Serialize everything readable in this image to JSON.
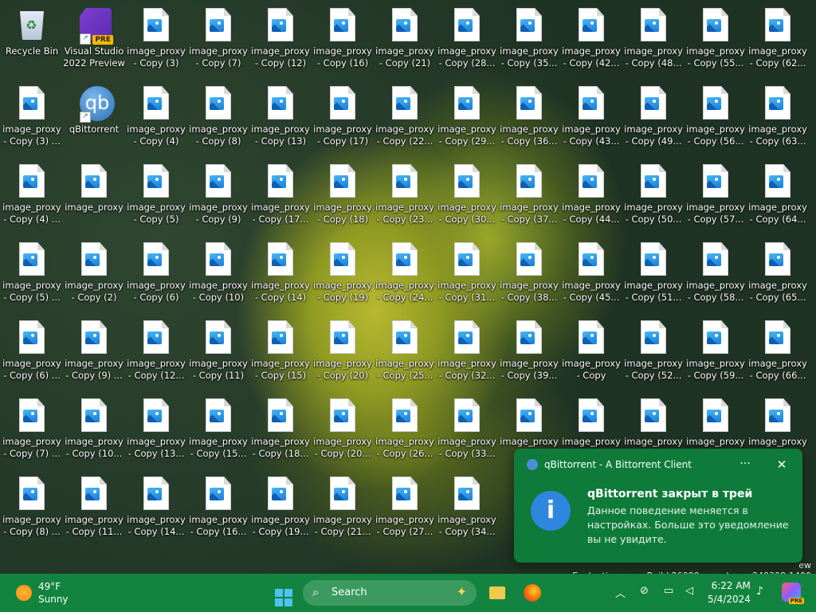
{
  "desktop": {
    "icons": [
      {
        "col": 0,
        "row": 0,
        "kind": "recycle",
        "l1": "Recycle Bin",
        "l2": ""
      },
      {
        "col": 1,
        "row": 0,
        "kind": "vs",
        "l1": "Visual Studio",
        "l2": "2022 Preview",
        "badge": "PRE"
      },
      {
        "col": 2,
        "row": 0,
        "kind": "file",
        "l1": "image_proxy",
        "l2": "- Copy (3)"
      },
      {
        "col": 3,
        "row": 0,
        "kind": "file",
        "l1": "image_proxy",
        "l2": "- Copy (7)"
      },
      {
        "col": 4,
        "row": 0,
        "kind": "file",
        "l1": "image_proxy",
        "l2": "- Copy (12)"
      },
      {
        "col": 5,
        "row": 0,
        "kind": "file",
        "l1": "image_proxy",
        "l2": "- Copy (16)"
      },
      {
        "col": 6,
        "row": 0,
        "kind": "file",
        "l1": "image_proxy",
        "l2": "- Copy (21)"
      },
      {
        "col": 7,
        "row": 0,
        "kind": "file",
        "l1": "image_proxy",
        "l2": "- Copy (28..."
      },
      {
        "col": 8,
        "row": 0,
        "kind": "file",
        "l1": "image_proxy",
        "l2": "- Copy (35..."
      },
      {
        "col": 9,
        "row": 0,
        "kind": "file",
        "l1": "image_proxy",
        "l2": "- Copy (42..."
      },
      {
        "col": 10,
        "row": 0,
        "kind": "file",
        "l1": "image_proxy",
        "l2": "- Copy (48..."
      },
      {
        "col": 11,
        "row": 0,
        "kind": "file",
        "l1": "image_proxy",
        "l2": "- Copy (55..."
      },
      {
        "col": 12,
        "row": 0,
        "kind": "file",
        "l1": "image_proxy",
        "l2": "- Copy (62..."
      },
      {
        "col": 0,
        "row": 1,
        "kind": "file",
        "l1": "image_proxy",
        "l2": "- Copy (3) ..."
      },
      {
        "col": 1,
        "row": 1,
        "kind": "qb",
        "l1": "qBittorrent",
        "l2": ""
      },
      {
        "col": 2,
        "row": 1,
        "kind": "file",
        "l1": "image_proxy",
        "l2": "- Copy (4)"
      },
      {
        "col": 3,
        "row": 1,
        "kind": "file",
        "l1": "image_proxy",
        "l2": "- Copy (8)"
      },
      {
        "col": 4,
        "row": 1,
        "kind": "file",
        "l1": "image_proxy",
        "l2": "- Copy (13)"
      },
      {
        "col": 5,
        "row": 1,
        "kind": "file",
        "l1": "image_proxy",
        "l2": "- Copy (17)"
      },
      {
        "col": 6,
        "row": 1,
        "kind": "file",
        "l1": "image_proxy",
        "l2": "- Copy (22..."
      },
      {
        "col": 7,
        "row": 1,
        "kind": "file",
        "l1": "image_proxy",
        "l2": "- Copy (29..."
      },
      {
        "col": 8,
        "row": 1,
        "kind": "file",
        "l1": "image_proxy",
        "l2": "- Copy (36..."
      },
      {
        "col": 9,
        "row": 1,
        "kind": "file",
        "l1": "image_proxy",
        "l2": "- Copy (43..."
      },
      {
        "col": 10,
        "row": 1,
        "kind": "file",
        "l1": "image_proxy",
        "l2": "- Copy (49..."
      },
      {
        "col": 11,
        "row": 1,
        "kind": "file",
        "l1": "image_proxy",
        "l2": "- Copy (56..."
      },
      {
        "col": 12,
        "row": 1,
        "kind": "file",
        "l1": "image_proxy",
        "l2": "- Copy (63..."
      },
      {
        "col": 0,
        "row": 2,
        "kind": "file",
        "l1": "image_proxy",
        "l2": "- Copy (4) ..."
      },
      {
        "col": 1,
        "row": 2,
        "kind": "file",
        "l1": "image_proxy",
        "l2": ""
      },
      {
        "col": 2,
        "row": 2,
        "kind": "file",
        "l1": "image_proxy",
        "l2": "- Copy (5)"
      },
      {
        "col": 3,
        "row": 2,
        "kind": "file",
        "l1": "image_proxy",
        "l2": "- Copy (9)"
      },
      {
        "col": 4,
        "row": 2,
        "kind": "file",
        "l1": "image_proxy",
        "l2": "- Copy (17..."
      },
      {
        "col": 5,
        "row": 2,
        "kind": "file",
        "l1": "image_proxy",
        "l2": "- Copy (18)"
      },
      {
        "col": 6,
        "row": 2,
        "kind": "file",
        "l1": "image_proxy",
        "l2": "- Copy (23..."
      },
      {
        "col": 7,
        "row": 2,
        "kind": "file",
        "l1": "image_proxy",
        "l2": "- Copy (30..."
      },
      {
        "col": 8,
        "row": 2,
        "kind": "file",
        "l1": "image_proxy",
        "l2": "- Copy (37..."
      },
      {
        "col": 9,
        "row": 2,
        "kind": "file",
        "l1": "image_proxy",
        "l2": "- Copy (44..."
      },
      {
        "col": 10,
        "row": 2,
        "kind": "file",
        "l1": "image_proxy",
        "l2": "- Copy (50..."
      },
      {
        "col": 11,
        "row": 2,
        "kind": "file",
        "l1": "image_proxy",
        "l2": "- Copy (57..."
      },
      {
        "col": 12,
        "row": 2,
        "kind": "file",
        "l1": "image_proxy",
        "l2": "- Copy (64..."
      },
      {
        "col": 0,
        "row": 3,
        "kind": "file",
        "l1": "image_proxy",
        "l2": "- Copy (5) ..."
      },
      {
        "col": 1,
        "row": 3,
        "kind": "file",
        "l1": "image_proxy",
        "l2": "- Copy (2)"
      },
      {
        "col": 2,
        "row": 3,
        "kind": "file",
        "l1": "image_proxy",
        "l2": "- Copy (6)"
      },
      {
        "col": 3,
        "row": 3,
        "kind": "file",
        "l1": "image_proxy",
        "l2": "- Copy (10)"
      },
      {
        "col": 4,
        "row": 3,
        "kind": "file",
        "l1": "image_proxy",
        "l2": "- Copy (14)"
      },
      {
        "col": 5,
        "row": 3,
        "kind": "file",
        "l1": "image_proxy",
        "l2": "- Copy (19)"
      },
      {
        "col": 6,
        "row": 3,
        "kind": "file",
        "l1": "image_proxy",
        "l2": "- Copy (24..."
      },
      {
        "col": 7,
        "row": 3,
        "kind": "file",
        "l1": "image_proxy",
        "l2": "- Copy (31..."
      },
      {
        "col": 8,
        "row": 3,
        "kind": "file",
        "l1": "image_proxy",
        "l2": "- Copy (38..."
      },
      {
        "col": 9,
        "row": 3,
        "kind": "file",
        "l1": "image_proxy",
        "l2": "- Copy (45..."
      },
      {
        "col": 10,
        "row": 3,
        "kind": "file",
        "l1": "image_proxy",
        "l2": "- Copy (51..."
      },
      {
        "col": 11,
        "row": 3,
        "kind": "file",
        "l1": "image_proxy",
        "l2": "- Copy (58..."
      },
      {
        "col": 12,
        "row": 3,
        "kind": "file",
        "l1": "image_proxy",
        "l2": "- Copy (65..."
      },
      {
        "col": 0,
        "row": 4,
        "kind": "file",
        "l1": "image_proxy",
        "l2": "- Copy (6) ..."
      },
      {
        "col": 1,
        "row": 4,
        "kind": "file",
        "l1": "image_proxy",
        "l2": "- Copy (9) ..."
      },
      {
        "col": 2,
        "row": 4,
        "kind": "file",
        "l1": "image_proxy",
        "l2": "- Copy (12..."
      },
      {
        "col": 3,
        "row": 4,
        "kind": "file",
        "l1": "image_proxy",
        "l2": "- Copy (11)"
      },
      {
        "col": 4,
        "row": 4,
        "kind": "file",
        "l1": "image_proxy",
        "l2": "- Copy (15)"
      },
      {
        "col": 5,
        "row": 4,
        "kind": "file",
        "l1": "image_proxy",
        "l2": "- Copy (20)"
      },
      {
        "col": 6,
        "row": 4,
        "kind": "file",
        "l1": "image_proxy",
        "l2": "- Copy (25..."
      },
      {
        "col": 7,
        "row": 4,
        "kind": "file",
        "l1": "image_proxy",
        "l2": "- Copy (32..."
      },
      {
        "col": 8,
        "row": 4,
        "kind": "file",
        "l1": "image_proxy",
        "l2": "- Copy (39..."
      },
      {
        "col": 9,
        "row": 4,
        "kind": "file",
        "l1": "image_proxy",
        "l2": "- Copy"
      },
      {
        "col": 10,
        "row": 4,
        "kind": "file",
        "l1": "image_proxy",
        "l2": "- Copy (52..."
      },
      {
        "col": 11,
        "row": 4,
        "kind": "file",
        "l1": "image_proxy",
        "l2": "- Copy (59..."
      },
      {
        "col": 12,
        "row": 4,
        "kind": "file",
        "l1": "image_proxy",
        "l2": "- Copy (66..."
      },
      {
        "col": 0,
        "row": 5,
        "kind": "file",
        "l1": "image_proxy",
        "l2": "- Copy (7) ..."
      },
      {
        "col": 1,
        "row": 5,
        "kind": "file",
        "l1": "image_proxy",
        "l2": "- Copy (10..."
      },
      {
        "col": 2,
        "row": 5,
        "kind": "file",
        "l1": "image_proxy",
        "l2": "- Copy (13..."
      },
      {
        "col": 3,
        "row": 5,
        "kind": "file",
        "l1": "image_proxy",
        "l2": "- Copy (15..."
      },
      {
        "col": 4,
        "row": 5,
        "kind": "file",
        "l1": "image_proxy",
        "l2": "- Copy (18..."
      },
      {
        "col": 5,
        "row": 5,
        "kind": "file",
        "l1": "image_proxy",
        "l2": "- Copy (20..."
      },
      {
        "col": 6,
        "row": 5,
        "kind": "file",
        "l1": "image_proxy",
        "l2": "- Copy (26..."
      },
      {
        "col": 7,
        "row": 5,
        "kind": "file",
        "l1": "image_proxy",
        "l2": "- Copy (33..."
      },
      {
        "col": 8,
        "row": 5,
        "kind": "file",
        "l1": "image_proxy",
        "l2": ""
      },
      {
        "col": 9,
        "row": 5,
        "kind": "file",
        "l1": "image_proxy",
        "l2": ""
      },
      {
        "col": 10,
        "row": 5,
        "kind": "file",
        "l1": "image_proxy",
        "l2": ""
      },
      {
        "col": 11,
        "row": 5,
        "kind": "file",
        "l1": "image_proxy",
        "l2": ""
      },
      {
        "col": 12,
        "row": 5,
        "kind": "file",
        "l1": "image_proxy",
        "l2": ""
      },
      {
        "col": 0,
        "row": 6,
        "kind": "file",
        "l1": "image_proxy",
        "l2": "- Copy (8) ..."
      },
      {
        "col": 1,
        "row": 6,
        "kind": "file",
        "l1": "image_proxy",
        "l2": "- Copy (11..."
      },
      {
        "col": 2,
        "row": 6,
        "kind": "file",
        "l1": "image_proxy",
        "l2": "- Copy (14..."
      },
      {
        "col": 3,
        "row": 6,
        "kind": "file",
        "l1": "image_proxy",
        "l2": "- Copy (16..."
      },
      {
        "col": 4,
        "row": 6,
        "kind": "file",
        "l1": "image_proxy",
        "l2": "- Copy (19..."
      },
      {
        "col": 5,
        "row": 6,
        "kind": "file",
        "l1": "image_proxy",
        "l2": "- Copy (21..."
      },
      {
        "col": 6,
        "row": 6,
        "kind": "file",
        "l1": "image_proxy",
        "l2": "- Copy (27..."
      },
      {
        "col": 7,
        "row": 6,
        "kind": "file",
        "l1": "image_proxy",
        "l2": "- Copy (34..."
      }
    ]
  },
  "watermark": {
    "line1": "ew",
    "line2": "Evaluation copy. Build 26080.ge_release.240308-1400"
  },
  "toast": {
    "app_name": "qBittorrent - A Bittorrent Client",
    "more_label": "···",
    "close_label": "✕",
    "info_glyph": "i",
    "title": "qBittorrent закрыт в трей",
    "body": "Данное поведение меняется в настройках. Больше это уведомление вы не увидите."
  },
  "taskbar": {
    "weather_temp": "49°F",
    "weather_desc": "Sunny",
    "search_placeholder": "Search",
    "search_spark": "✦",
    "tray_chevron": "︿",
    "clock_time": "6:22 AM",
    "clock_date": "5/4/2024",
    "copilot_badge": "PRE"
  },
  "colors": {
    "taskbar_bg": "#12843f",
    "toast_bg": "#0f7b3a",
    "info_icon": "#2e86de"
  }
}
